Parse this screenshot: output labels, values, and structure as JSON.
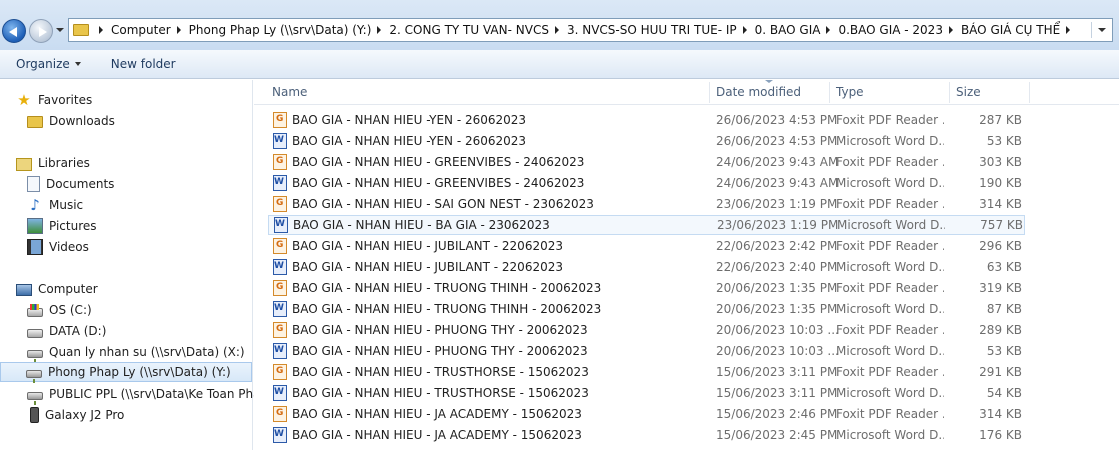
{
  "address": {
    "crumbs": [
      "Computer",
      "Phong Phap Ly (\\\\srv\\Data) (Y:)",
      "2. CONG TY TU VAN- NVCS",
      "3. NVCS-SO HUU TRI TUE- IP",
      "0. BAO GIA",
      "0.BAO GIA - 2023",
      "BÁO GIÁ CỤ THỂ"
    ]
  },
  "toolbar": {
    "organize": "Organize",
    "new_folder": "New folder"
  },
  "nav": {
    "favorites": "Favorites",
    "downloads": "Downloads",
    "libraries": "Libraries",
    "documents": "Documents",
    "music": "Music",
    "pictures": "Pictures",
    "videos": "Videos",
    "computer": "Computer",
    "os": "OS (C:)",
    "data": "DATA (D:)",
    "quanly": "Quan ly nhan su (\\\\srv\\Data) (X:)",
    "phongphaply": "Phong Phap Ly (\\\\srv\\Data) (Y:)",
    "public": "PUBLIC PPL (\\\\srv\\Data\\Ke Toan Phap",
    "galaxy": "Galaxy J2 Pro"
  },
  "columns": {
    "name": "Name",
    "date": "Date modified",
    "type": "Type",
    "size": "Size"
  },
  "files": [
    {
      "name": "BAO GIA - NHAN HIEU -YEN - 26062023",
      "date": "26/06/2023 4:53 PM",
      "type": "Foxit PDF Reader ...",
      "size": "287 KB",
      "icon": "pdf-icon"
    },
    {
      "name": "BAO GIA - NHAN HIEU -YEN - 26062023",
      "date": "26/06/2023 4:53 PM",
      "type": "Microsoft Word D...",
      "size": "53 KB",
      "icon": "word-icon"
    },
    {
      "name": "BAO GIA - NHAN HIEU - GREENVIBES - 24062023",
      "date": "24/06/2023 9:43 AM",
      "type": "Foxit PDF Reader ...",
      "size": "303 KB",
      "icon": "pdf-icon"
    },
    {
      "name": "BAO GIA - NHAN HIEU - GREENVIBES - 24062023",
      "date": "24/06/2023 9:43 AM",
      "type": "Microsoft Word D...",
      "size": "190 KB",
      "icon": "word-icon"
    },
    {
      "name": "BAO GIA - NHAN HIEU - SAI GON NEST - 23062023",
      "date": "23/06/2023 1:19 PM",
      "type": "Foxit PDF Reader ...",
      "size": "314 KB",
      "icon": "pdf-icon"
    },
    {
      "name": "BAO GIA - NHAN HIEU - BA GIA - 23062023",
      "date": "23/06/2023 1:19 PM",
      "type": "Microsoft Word D...",
      "size": "757 KB",
      "icon": "word-icon"
    },
    {
      "name": "BAO GIA - NHAN HIEU - JUBILANT - 22062023",
      "date": "22/06/2023 2:42 PM",
      "type": "Foxit PDF Reader ...",
      "size": "296 KB",
      "icon": "pdf-icon"
    },
    {
      "name": "BAO GIA - NHAN HIEU - JUBILANT - 22062023",
      "date": "22/06/2023 2:40 PM",
      "type": "Microsoft Word D...",
      "size": "63 KB",
      "icon": "word-icon"
    },
    {
      "name": "BAO GIA - NHAN HIEU - TRUONG THINH - 20062023",
      "date": "20/06/2023 1:35 PM",
      "type": "Foxit PDF Reader ...",
      "size": "319 KB",
      "icon": "pdf-icon"
    },
    {
      "name": "BAO GIA - NHAN HIEU - TRUONG THINH - 20062023",
      "date": "20/06/2023 1:35 PM",
      "type": "Microsoft Word D...",
      "size": "87 KB",
      "icon": "word-icon"
    },
    {
      "name": "BAO GIA - NHAN HIEU - PHUONG THY - 20062023",
      "date": "20/06/2023 10:03 ...",
      "type": "Foxit PDF Reader ...",
      "size": "289 KB",
      "icon": "pdf-icon"
    },
    {
      "name": "BAO GIA - NHAN HIEU - PHUONG THY - 20062023",
      "date": "20/06/2023 10:03 ...",
      "type": "Microsoft Word D...",
      "size": "53 KB",
      "icon": "word-icon"
    },
    {
      "name": "BAO GIA - NHAN HIEU - TRUSTHORSE - 15062023",
      "date": "15/06/2023 3:11 PM",
      "type": "Foxit PDF Reader ...",
      "size": "291 KB",
      "icon": "pdf-icon"
    },
    {
      "name": "BAO GIA - NHAN HIEU - TRUSTHORSE - 15062023",
      "date": "15/06/2023 3:11 PM",
      "type": "Microsoft Word D...",
      "size": "54 KB",
      "icon": "word-icon"
    },
    {
      "name": "BAO GIA - NHAN HIEU - JA ACADEMY - 15062023",
      "date": "15/06/2023 2:46 PM",
      "type": "Foxit PDF Reader ...",
      "size": "314 KB",
      "icon": "pdf-icon"
    },
    {
      "name": "BAO GIA - NHAN HIEU - JA ACADEMY - 15062023",
      "date": "15/06/2023 2:45 PM",
      "type": "Microsoft Word D...",
      "size": "176 KB",
      "icon": "word-icon"
    }
  ]
}
